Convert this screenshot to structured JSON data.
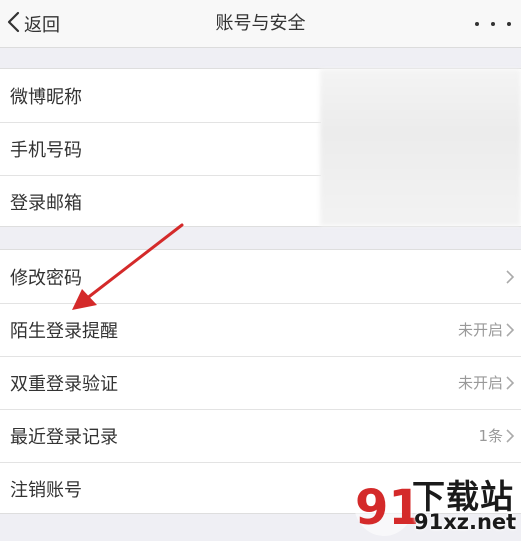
{
  "navbar": {
    "back_label": "返回",
    "title": "账号与安全"
  },
  "group1": [
    {
      "label": "微博昵称"
    },
    {
      "label": "手机号码"
    },
    {
      "label": "登录邮箱"
    }
  ],
  "group2": [
    {
      "label": "修改密码",
      "value": ""
    },
    {
      "label": "陌生登录提醒",
      "value": "未开启"
    },
    {
      "label": "双重登录验证",
      "value": "未开启"
    },
    {
      "label": "最近登录记录",
      "value": "1条"
    },
    {
      "label": "注销账号",
      "value": ""
    }
  ],
  "watermark": {
    "brand": "下载站",
    "url": "91xz.net",
    "logo_text": "91"
  },
  "colors": {
    "arrow": "#d42a2a",
    "watermark_red": "#d42a2a"
  }
}
